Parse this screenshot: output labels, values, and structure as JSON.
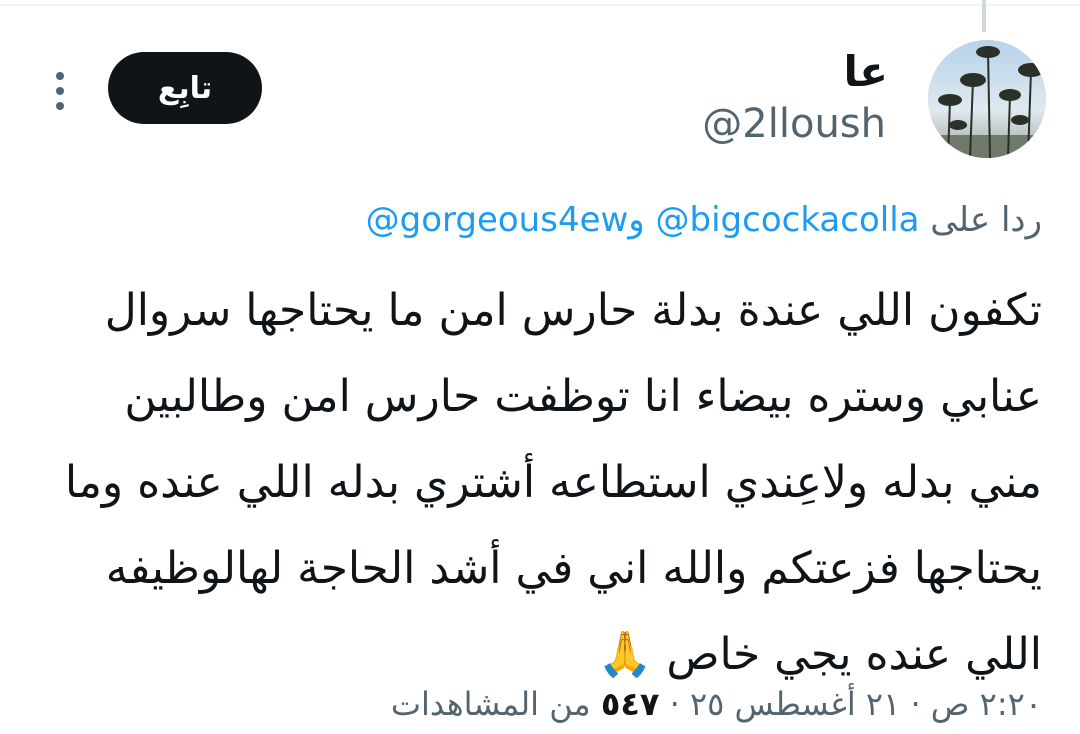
{
  "author": {
    "display_name": "عا",
    "handle": "@2lloush"
  },
  "actions": {
    "follow_label": "تابِع",
    "more_icon": "more-vertical-icon"
  },
  "reply_context": {
    "prefix": "ردا على",
    "mention_1": "@bigcockacolla",
    "joiner": "و",
    "mention_2": "@gorgeous4ew"
  },
  "tweet": {
    "lines": [
      "تكفون اللي عندة بدلة حارس امن ما يحتاجها سروال",
      "عنابي وستره بيضاء انا توظفت حارس امن وطالبين",
      "مني بدله ولاعِندي استطاعه أشتري بدله اللي عنده وما",
      "يحتاجها فزعتكم والله اني في أشد الحاجة لهالوظيفه",
      "اللي عنده يجي خاص 🙏"
    ]
  },
  "meta": {
    "time": "٢:٢٠ ص",
    "date": "٢١ أغسطس ٢٥",
    "separator": "·",
    "views_count": "٥٤٧",
    "views_label": "من المشاهدات"
  },
  "colors": {
    "text_primary": "#0f1419",
    "text_secondary": "#536471",
    "link": "#1d9bf0",
    "button_bg": "#0f1419"
  }
}
